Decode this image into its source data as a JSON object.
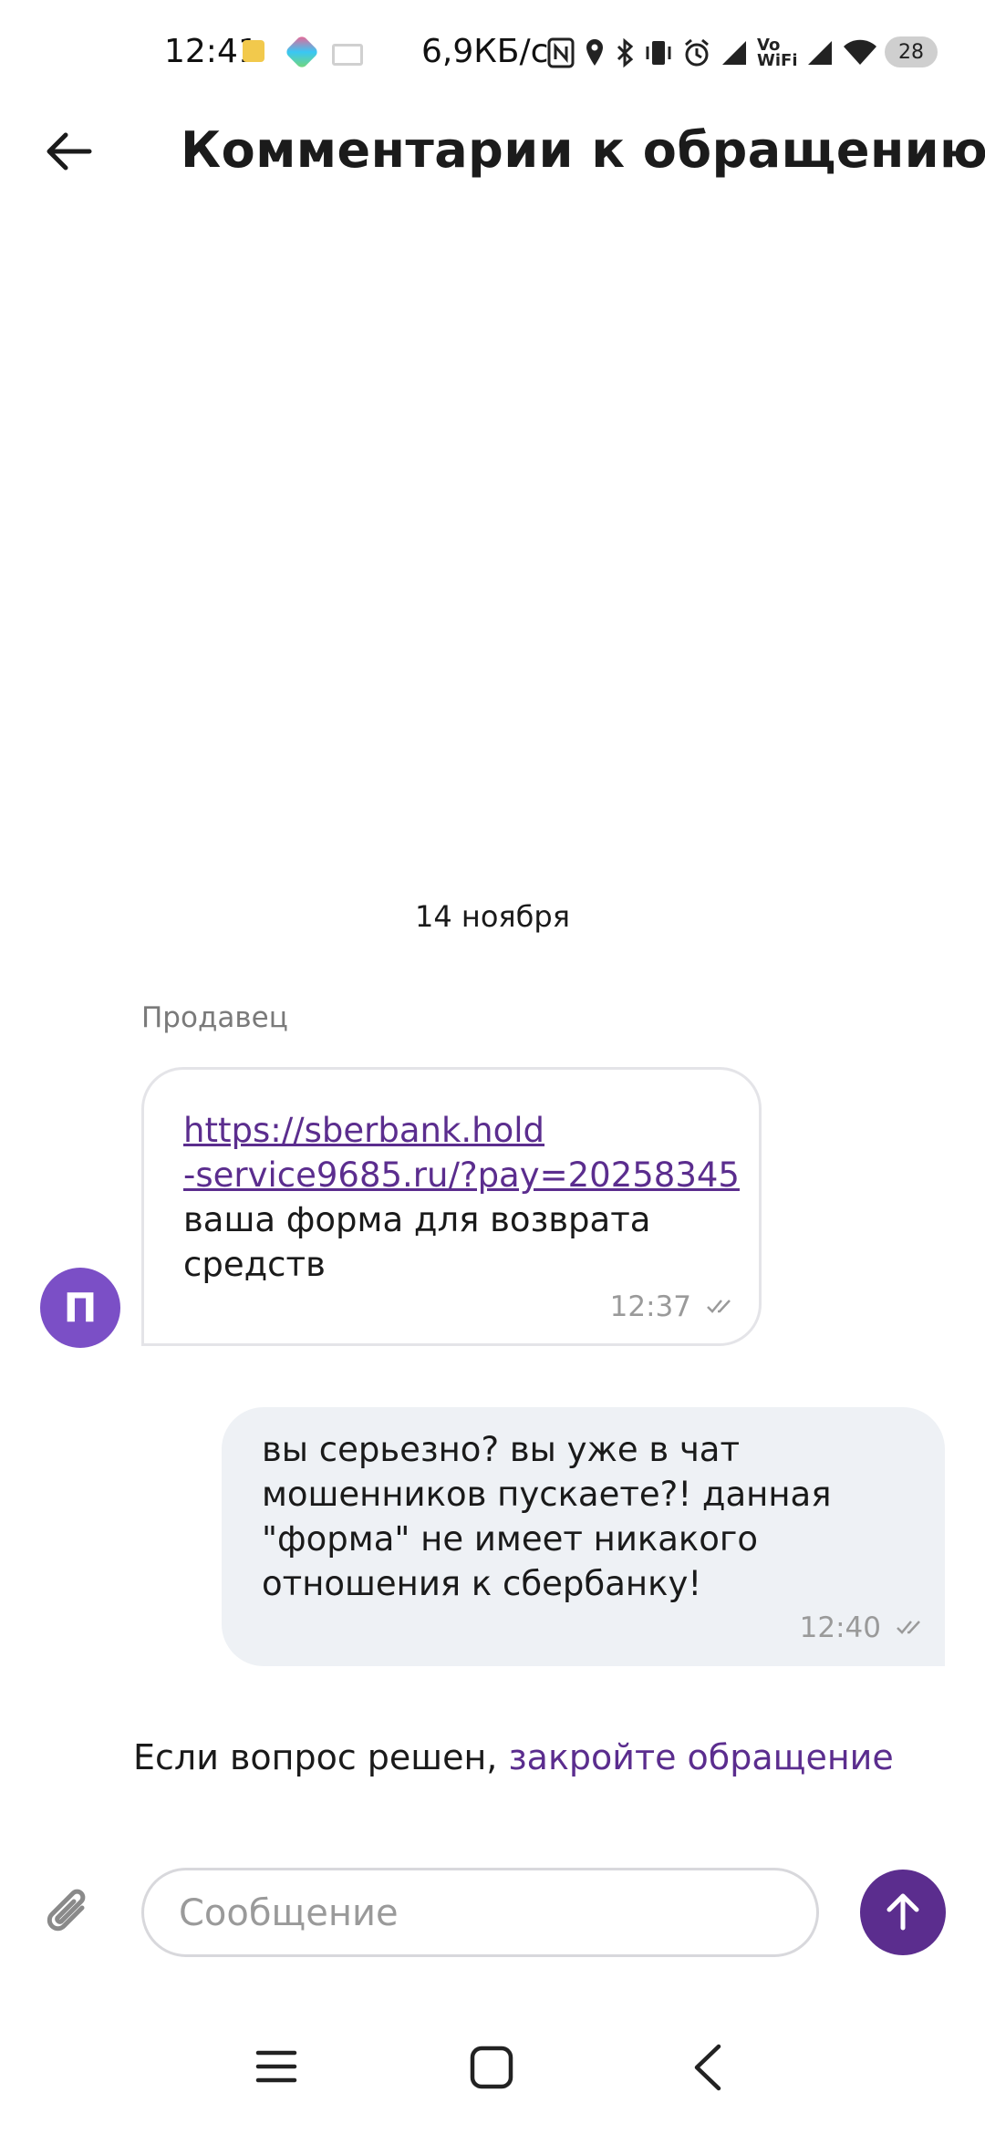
{
  "status_bar": {
    "time": "12:41",
    "network_speed": "6,9КБ/с",
    "battery": "28",
    "icons": [
      "notification-icon",
      "app-icon",
      "mail-icon",
      "nfc-icon",
      "location-icon",
      "bluetooth-icon",
      "vibrate-icon",
      "alarm-icon",
      "signal-icon",
      "vowifi-icon",
      "signal-icon",
      "wifi-icon",
      "battery-icon"
    ],
    "vowifi_label": "Vo WiFi"
  },
  "header": {
    "title": "Комментарии к обращению",
    "back_icon": "arrow-left-icon"
  },
  "chat": {
    "date": "14 ноября",
    "incoming": {
      "sender": "Продавец",
      "avatar_letter": "П",
      "link_line1": "https://sberbank.hold",
      "link_line2": "-service9685.ru/?pay=20258345",
      "text": "ваша форма для возврата средств",
      "time": "12:37"
    },
    "outgoing": {
      "text": "вы серьезно? вы уже в чат мошенников пускаете?! данная \"форма\" не имеет никакого отношения к сбербанку!",
      "time": "12:40"
    }
  },
  "close_hint": {
    "text": "Если вопрос решен, ",
    "link": "закройте обращение"
  },
  "composer": {
    "placeholder": "Сообщение",
    "value": "",
    "attach_icon": "paperclip-icon",
    "send_icon": "arrow-up-icon"
  },
  "colors": {
    "accent": "#5b2d8e",
    "avatar": "#7b4fc6",
    "outgoing_bubble": "#eef1f5"
  }
}
